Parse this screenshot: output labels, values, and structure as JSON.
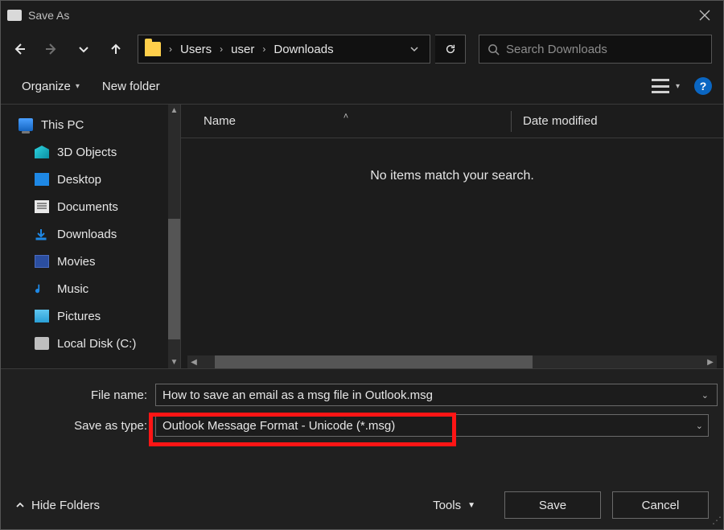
{
  "titlebar": {
    "title": "Save As"
  },
  "nav": {
    "crumbs": [
      "Users",
      "user",
      "Downloads"
    ]
  },
  "search": {
    "placeholder": "Search Downloads"
  },
  "toolbar": {
    "organize": "Organize",
    "newfolder": "New folder"
  },
  "sidebar": {
    "items": [
      {
        "label": "This PC"
      },
      {
        "label": "3D Objects"
      },
      {
        "label": "Desktop"
      },
      {
        "label": "Documents"
      },
      {
        "label": "Downloads"
      },
      {
        "label": "Movies"
      },
      {
        "label": "Music"
      },
      {
        "label": "Pictures"
      },
      {
        "label": "Local Disk (C:)"
      }
    ]
  },
  "columns": {
    "name": "Name",
    "date": "Date modified"
  },
  "list": {
    "empty": "No items match your search."
  },
  "fields": {
    "filename_label": "File name:",
    "filename_value": "How to save an email as a msg file in Outlook.msg",
    "savetype_label": "Save as type:",
    "savetype_value": "Outlook Message Format - Unicode (*.msg)"
  },
  "footer": {
    "hide": "Hide Folders",
    "tools": "Tools",
    "save": "Save",
    "cancel": "Cancel"
  },
  "help": "?"
}
